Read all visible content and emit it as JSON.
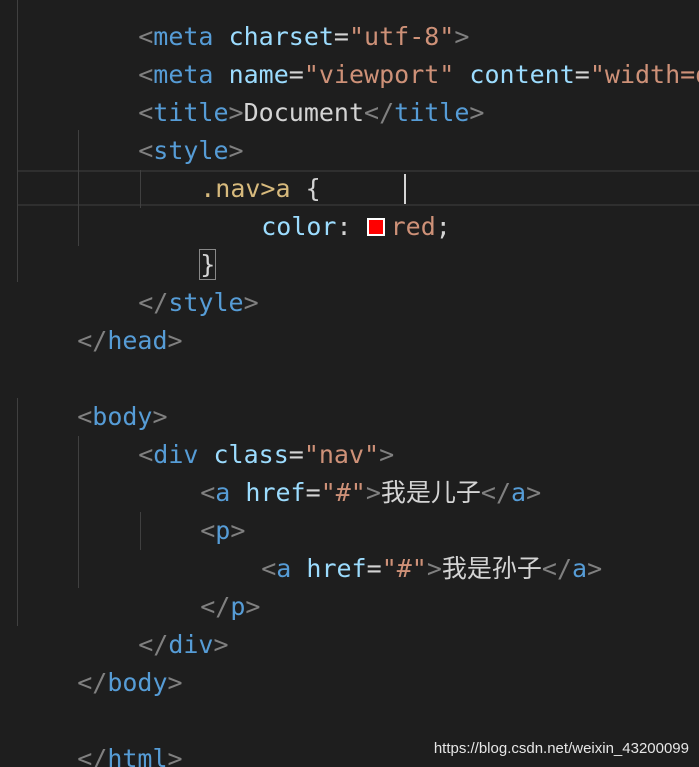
{
  "editor": {
    "language": "html",
    "swatch_color": "#ff0000",
    "line1": {
      "open": "<",
      "tag": "meta",
      "space": " ",
      "attr": "charset",
      "eq": "=",
      "value": "\"utf-8\"",
      "close": ">"
    },
    "line2": {
      "open": "<",
      "tag": "meta",
      "attr1": "name",
      "value1": "\"viewport\"",
      "attr2": "content",
      "value2": "\"width=devi"
    },
    "line3": {
      "tag": "title",
      "text": "Document"
    },
    "line4": {
      "tag": "style"
    },
    "line5": {
      "selector": ".nav>a",
      "brace": "{"
    },
    "line6": {
      "property": "color",
      "colon": ":",
      "value": "red",
      "semicolon": ";"
    },
    "line7": {
      "brace": "}"
    },
    "line8": {
      "tag": "style"
    },
    "line9": {
      "tag": "head"
    },
    "line11": {
      "tag": "body"
    },
    "line12": {
      "tag": "div",
      "attr": "class",
      "value": "\"nav\""
    },
    "line13": {
      "tag": "a",
      "attr": "href",
      "value": "\"#\"",
      "text": "我是儿子"
    },
    "line14": {
      "tag": "p"
    },
    "line15": {
      "tag": "a",
      "attr": "href",
      "value": "\"#\"",
      "text": "我是孙子"
    },
    "line16": {
      "tag": "p"
    },
    "line17": {
      "tag": "div"
    },
    "line18": {
      "tag": "body"
    },
    "line20": {
      "tag": "html"
    }
  },
  "watermark": "https://blog.csdn.net/weixin_43200099"
}
